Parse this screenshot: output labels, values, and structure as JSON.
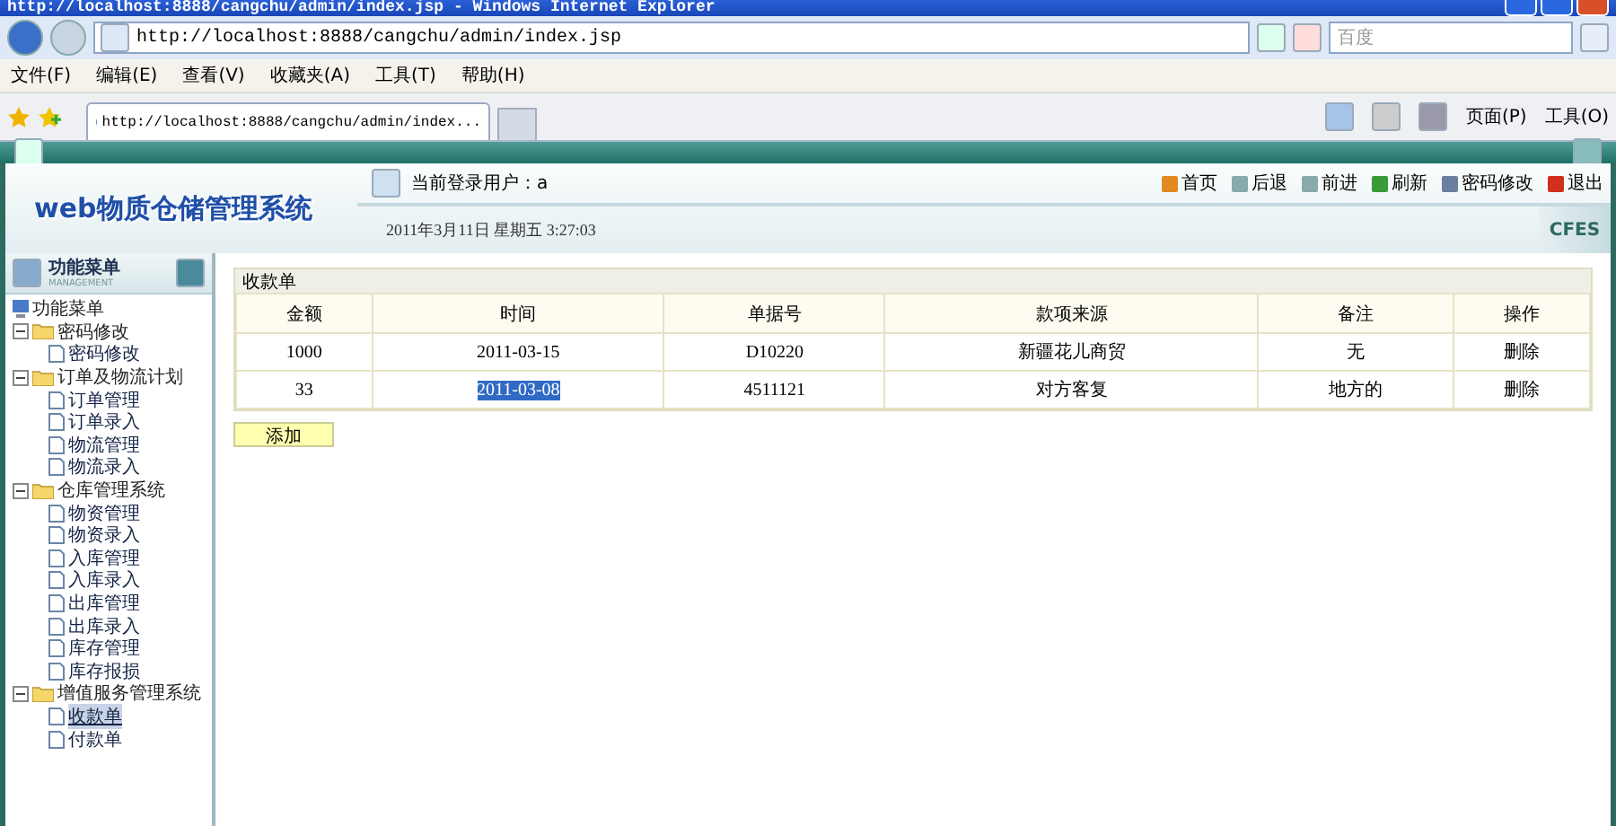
{
  "window": {
    "title": "http://localhost:8888/cangchu/admin/index.jsp - Windows Internet Explorer"
  },
  "address_bar": {
    "url": "http://localhost:8888/cangchu/admin/index.jsp",
    "search_placeholder": "百度"
  },
  "menu_bar": [
    "文件(F)",
    "编辑(E)",
    "查看(V)",
    "收藏夹(A)",
    "工具(T)",
    "帮助(H)"
  ],
  "tabs": [
    {
      "label": "http://localhost:8888/cangchu/admin/index...",
      "selected": true
    }
  ],
  "command_bar": [
    "页面(P)",
    "工具(O)"
  ],
  "app": {
    "logo": "web物质仓储管理系统",
    "current_user": "当前登录用户：a",
    "date": "2011年3月11日  星期五  3:27:03",
    "brand": "CFES",
    "toolbar": [
      "首页",
      "后退",
      "前进",
      "刷新",
      "密码修改",
      "退出"
    ]
  },
  "sidebar": {
    "title": "功能菜单",
    "subtitle": "MANAGEMENT",
    "root": "功能菜单",
    "groups": [
      {
        "label": "密码修改",
        "expanded": true,
        "children": [
          {
            "label": "密码修改",
            "selected": false
          }
        ]
      },
      {
        "label": "订单及物流计划",
        "expanded": true,
        "children": [
          {
            "label": "订单管理",
            "selected": false
          },
          {
            "label": "订单录入",
            "selected": false
          },
          {
            "label": "物流管理",
            "selected": false
          },
          {
            "label": "物流录入",
            "selected": false
          }
        ]
      },
      {
        "label": "仓库管理系统",
        "expanded": true,
        "children": [
          {
            "label": "物资管理",
            "selected": false
          },
          {
            "label": "物资录入",
            "selected": false
          },
          {
            "label": "入库管理",
            "selected": false
          },
          {
            "label": "入库录入",
            "selected": false
          },
          {
            "label": "出库管理",
            "selected": false
          },
          {
            "label": "出库录入",
            "selected": false
          },
          {
            "label": "库存管理",
            "selected": false
          },
          {
            "label": "库存报损",
            "selected": false
          }
        ]
      },
      {
        "label": "增值服务管理系统",
        "expanded": true,
        "children": [
          {
            "label": "收款单",
            "selected": true
          },
          {
            "label": "付款单",
            "selected": false
          }
        ]
      }
    ]
  },
  "panel": {
    "title": "收款单",
    "columns": [
      "金额",
      "时间",
      "单据号",
      "款项来源",
      "备注",
      "操作"
    ],
    "rows": [
      {
        "cells": [
          "1000",
          "2011-03-15",
          "D10220",
          "新疆花儿商贸",
          "无",
          "删除"
        ],
        "time_highlighted": false
      },
      {
        "cells": [
          "33",
          "2011-03-08",
          "4511121",
          "对方客复",
          "地方的",
          "删除"
        ],
        "time_highlighted": true
      }
    ],
    "add_button": "添加"
  }
}
